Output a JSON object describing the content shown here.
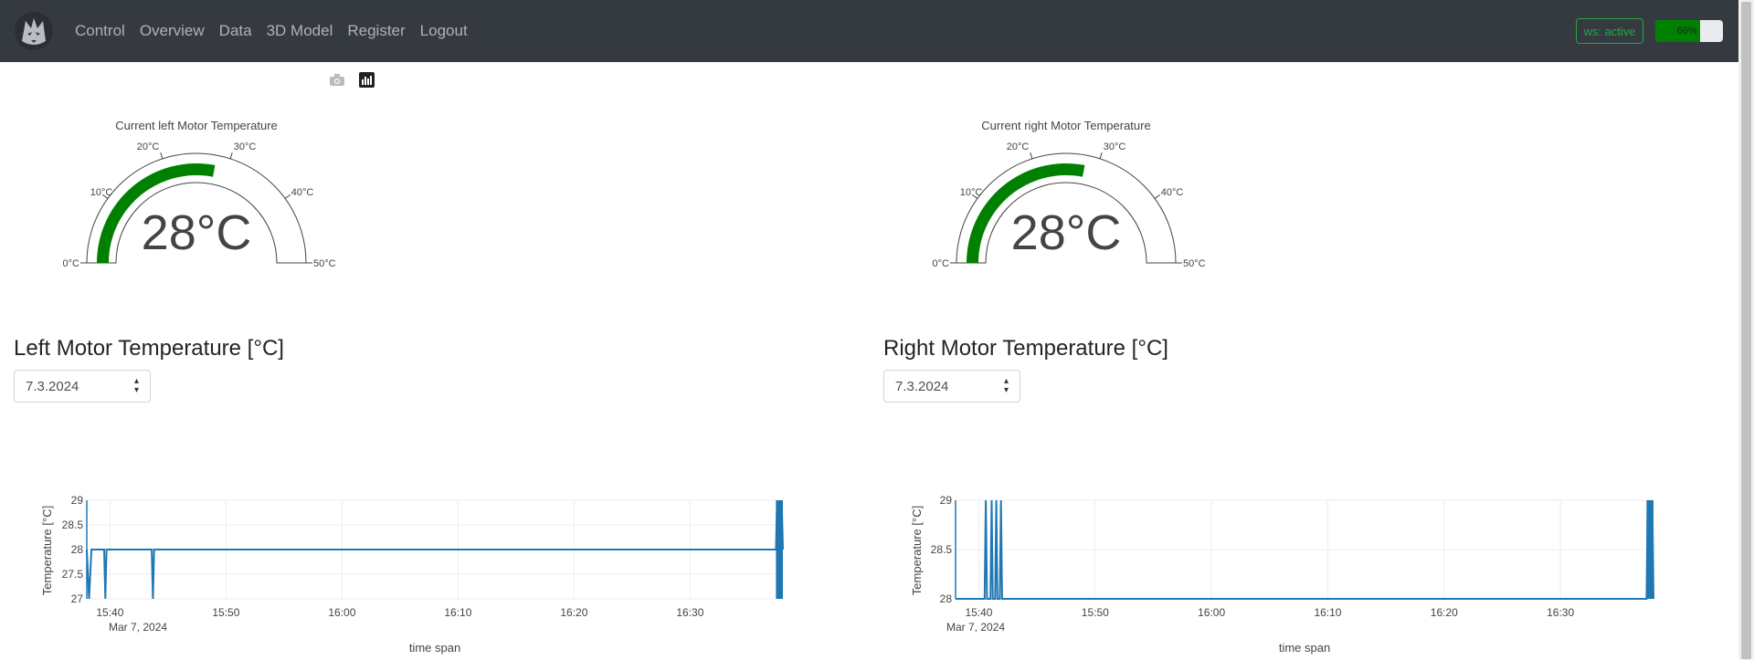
{
  "nav": {
    "links": [
      "Control",
      "Overview",
      "Data",
      "3D Model",
      "Register",
      "Logout"
    ],
    "ws_status": "ws: active",
    "battery_text": "66%",
    "battery_level": 0.66
  },
  "gauges": [
    {
      "title": "Current left Motor Temperature",
      "value_text": "28°C",
      "value": 28,
      "min": 0,
      "max": 50,
      "ticks": [
        "0°C",
        "10°C",
        "20°C",
        "30°C",
        "40°C",
        "50°C"
      ]
    },
    {
      "title": "Current right Motor Temperature",
      "value_text": "28°C",
      "value": 28,
      "min": 0,
      "max": 50,
      "ticks": [
        "0°C",
        "10°C",
        "20°C",
        "30°C",
        "40°C",
        "50°C"
      ]
    }
  ],
  "sections": [
    {
      "title": "Left Motor Temperature [°C]",
      "date": "7.3.2024"
    },
    {
      "title": "Right Motor Temperature [°C]",
      "date": "7.3.2024"
    }
  ],
  "colors": {
    "gauge_bar": "#008000",
    "line": "#1f77b4",
    "nav_bg": "#343a40",
    "ws": "#28a745"
  },
  "chart_data": [
    {
      "type": "line",
      "xlabel": "time span",
      "ylabel": "Temperature [°C]",
      "x_ticks": [
        "15:40",
        "15:50",
        "16:00",
        "16:10",
        "16:20",
        "16:30"
      ],
      "x_date_label": "Mar 7, 2024",
      "y_ticks": [
        "29",
        "28.5",
        "28",
        "27.5",
        "27"
      ],
      "ylim": [
        27,
        29
      ],
      "xlim": [
        "15:38",
        "16:38"
      ],
      "series": [
        {
          "points": [
            [
              "15:38",
              28
            ],
            [
              "15:38.2",
              27
            ],
            [
              "15:38.4",
              28
            ],
            [
              "15:39.5",
              28
            ],
            [
              "15:39.6",
              27
            ],
            [
              "15:39.7",
              28
            ],
            [
              "15:43.6",
              28
            ],
            [
              "15:43.7",
              27
            ],
            [
              "15:43.8",
              28
            ],
            [
              "16:37.4",
              28
            ],
            [
              "16:37.5",
              29
            ],
            [
              "16:37.6",
              28
            ],
            [
              "16:37.7",
              29
            ],
            [
              "16:37.8",
              28
            ],
            [
              "16:37.9",
              29
            ],
            [
              "16:38",
              28
            ]
          ]
        }
      ]
    },
    {
      "type": "line",
      "xlabel": "time span",
      "ylabel": "Temperature [°C]",
      "x_ticks": [
        "15:40",
        "15:50",
        "16:00",
        "16:10",
        "16:20",
        "16:30"
      ],
      "x_date_label": "Mar 7, 2024",
      "y_ticks": [
        "29",
        "28.5",
        "28"
      ],
      "ylim": [
        28,
        29
      ],
      "xlim": [
        "15:38",
        "16:38"
      ],
      "series": [
        {
          "points": [
            [
              "15:38",
              28
            ],
            [
              "15:40.5",
              28
            ],
            [
              "15:40.6",
              29
            ],
            [
              "15:40.7",
              28
            ],
            [
              "15:41.0",
              28
            ],
            [
              "15:41.1",
              29
            ],
            [
              "15:41.2",
              28
            ],
            [
              "15:41.4",
              28
            ],
            [
              "15:41.5",
              29
            ],
            [
              "15:41.6",
              28
            ],
            [
              "15:41.8",
              28
            ],
            [
              "15:41.9",
              29
            ],
            [
              "15:42.0",
              28
            ],
            [
              "16:37.4",
              28
            ],
            [
              "16:37.5",
              29
            ],
            [
              "16:37.6",
              28
            ],
            [
              "16:37.7",
              29
            ],
            [
              "16:37.8",
              28
            ],
            [
              "16:37.9",
              29
            ],
            [
              "16:38",
              28
            ]
          ]
        }
      ]
    }
  ]
}
